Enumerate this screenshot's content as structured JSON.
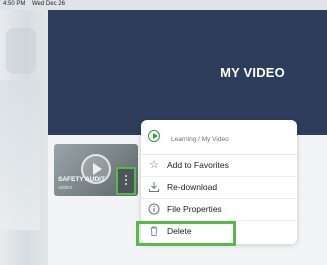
{
  "status_bar": {
    "time": "4:50 PM",
    "date": "Wed Dec 26"
  },
  "hero": {
    "title": "MY VIDEO"
  },
  "video_card": {
    "title": "SAFETY AUDIT",
    "type": "VIDEO"
  },
  "context_menu": {
    "breadcrumb": "Learning / My Video",
    "items": [
      {
        "label": "Add to Favorites",
        "icon": "star-icon"
      },
      {
        "label": "Re-download",
        "icon": "download-icon"
      },
      {
        "label": "File Properties",
        "icon": "info-icon"
      },
      {
        "label": "Delete",
        "icon": "trash-icon"
      }
    ]
  },
  "colors": {
    "highlight": "#58b94a",
    "hero_bg": "#2e3d5c",
    "accent_green": "#2e9b3d"
  }
}
